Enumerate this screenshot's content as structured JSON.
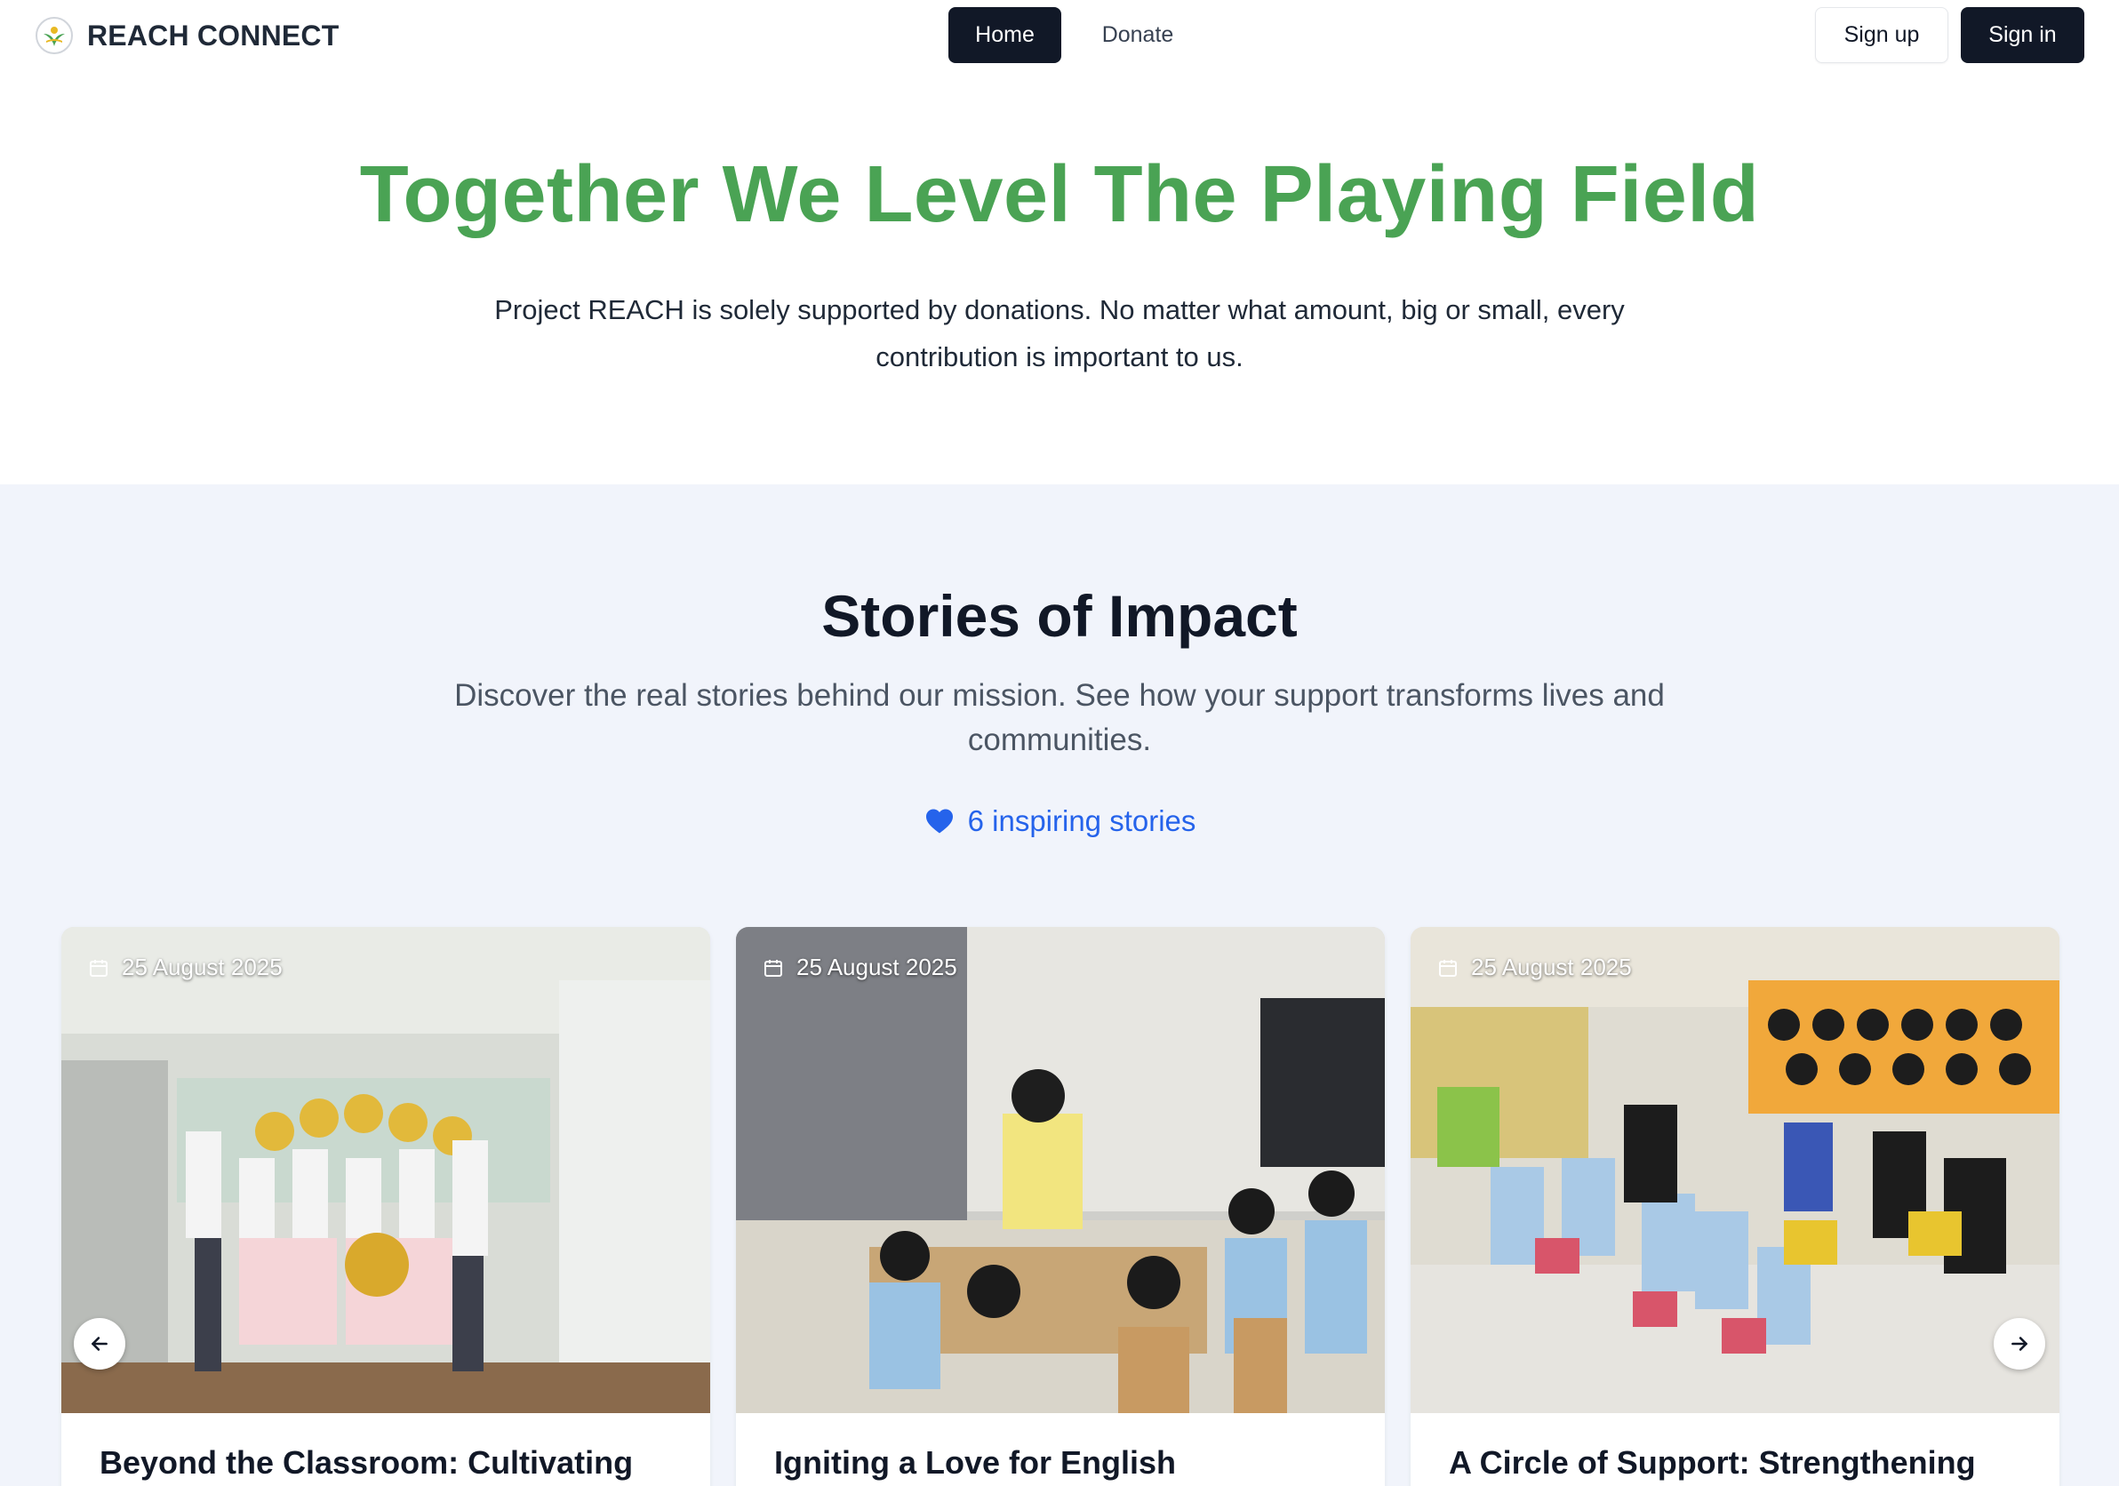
{
  "header": {
    "brand": "REACH CONNECT",
    "nav": {
      "home": "Home",
      "donate": "Donate"
    },
    "auth": {
      "signup": "Sign up",
      "signin": "Sign in"
    }
  },
  "hero": {
    "title": "Together We Level The Playing Field",
    "subtitle": "Project REACH is solely supported by donations. No matter what amount, big or small, every contribution is important to us."
  },
  "stories": {
    "title": "Stories of Impact",
    "subtitle": "Discover the real stories behind our mission. See how your support transforms lives and communities.",
    "count_label": "6 inspiring stories",
    "cards": [
      {
        "date": "25 August 2025",
        "title": "Beyond the Classroom: Cultivating"
      },
      {
        "date": "25 August 2025",
        "title": "Igniting a Love for English"
      },
      {
        "date": "25 August 2025",
        "title": "A Circle of Support: Strengthening"
      }
    ]
  },
  "colors": {
    "brand_green": "#4aa354",
    "dark": "#111827",
    "accent_blue": "#2563eb",
    "section_bg": "#f1f4fb"
  },
  "icons": [
    "logo-icon",
    "heart-icon",
    "calendar-icon",
    "arrow-left-icon",
    "arrow-right-icon"
  ]
}
